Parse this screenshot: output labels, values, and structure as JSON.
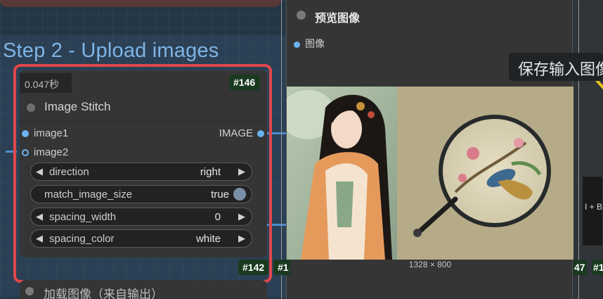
{
  "canvas": {
    "group_title": "Step 2 - Upload images"
  },
  "stitch_node": {
    "exec_time": "0.047秒",
    "node_id": "#146",
    "title": "Image Stitch",
    "inputs": [
      "image1",
      "image2"
    ],
    "output": "IMAGE",
    "widgets": {
      "direction": {
        "label": "direction",
        "value": "right"
      },
      "match_image_size": {
        "label": "match_image_size",
        "value": "true"
      },
      "spacing_width": {
        "label": "spacing_width",
        "value": "0"
      },
      "spacing_color": {
        "label": "spacing_color",
        "value": "white"
      }
    }
  },
  "preview_node": {
    "title": "预览图像",
    "input": "图像",
    "dimensions": "1328 × 800"
  },
  "bottom_node": {
    "title": "加载图像（来自输出）"
  },
  "badges": {
    "left_bottom": "#142",
    "left_bottom_partial": "#1",
    "right_bottom": "47",
    "right_bottom_partial": "#1"
  },
  "tooltip": {
    "text": "保存输入图像"
  },
  "right_node": {
    "text": "I + B"
  },
  "colors": {
    "highlight_border": "#e0474c",
    "link": "#4a8ed0",
    "group_title": "#7fb4e6",
    "badge_bg": "#1a3a20"
  }
}
